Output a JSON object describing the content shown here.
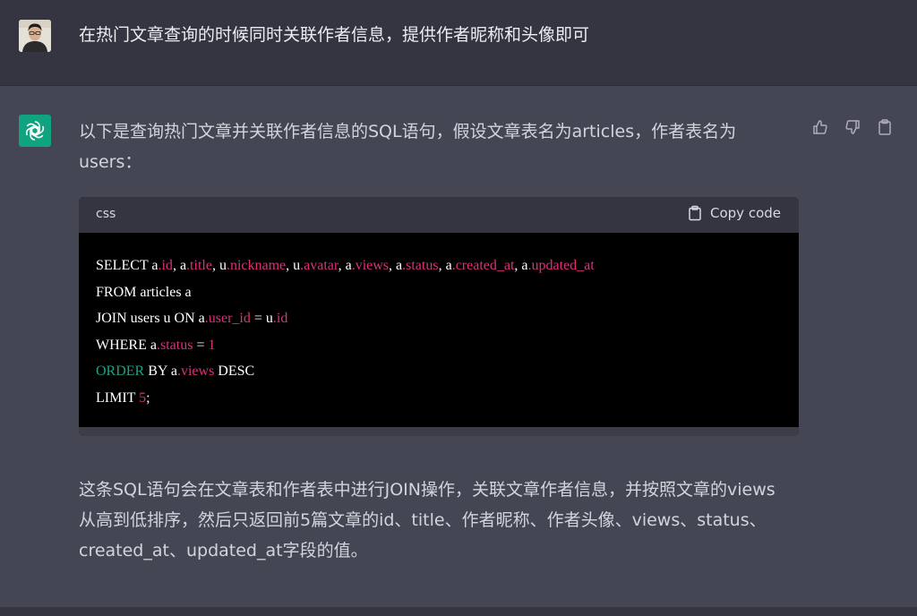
{
  "user_message": {
    "avatar_icon": "user-avatar-photo",
    "text": "在热门文章查询的时候同时关联作者信息，提供作者昵称和头像即可"
  },
  "assistant_message": {
    "avatar_icon": "openai-logo-icon",
    "accent_color": "#10a37f",
    "actions": [
      "thumbs-up-icon",
      "thumbs-down-icon",
      "clipboard-icon"
    ],
    "intro": "以下是查询热门文章并关联作者信息的SQL语句，假设文章表名为articles，作者表名为users：",
    "code_block": {
      "language": "css",
      "copy_label": "Copy code",
      "lines": [
        [
          {
            "t": "SELECT a",
            "c": "plain"
          },
          {
            "t": ".id",
            "c": "prop"
          },
          {
            "t": ", a",
            "c": "plain"
          },
          {
            "t": ".title",
            "c": "prop"
          },
          {
            "t": ", u",
            "c": "plain"
          },
          {
            "t": ".nickname",
            "c": "prop"
          },
          {
            "t": ", u",
            "c": "plain"
          },
          {
            "t": ".avatar",
            "c": "prop"
          },
          {
            "t": ", a",
            "c": "plain"
          },
          {
            "t": ".views",
            "c": "prop"
          },
          {
            "t": ", a",
            "c": "plain"
          },
          {
            "t": ".status",
            "c": "prop"
          },
          {
            "t": ", a",
            "c": "plain"
          },
          {
            "t": ".created_at",
            "c": "prop"
          },
          {
            "t": ", a",
            "c": "plain"
          },
          {
            "t": ".updated_at",
            "c": "prop"
          }
        ],
        [
          {
            "t": "FROM articles a",
            "c": "plain"
          }
        ],
        [
          {
            "t": "JOIN users u ON a",
            "c": "plain"
          },
          {
            "t": ".user_id",
            "c": "prop"
          },
          {
            "t": " = u",
            "c": "plain"
          },
          {
            "t": ".id",
            "c": "prop"
          }
        ],
        [
          {
            "t": "WHERE a",
            "c": "plain"
          },
          {
            "t": ".status",
            "c": "prop"
          },
          {
            "t": " = ",
            "c": "plain"
          },
          {
            "t": "1",
            "c": "num"
          }
        ],
        [
          {
            "t": "ORDER",
            "c": "kw"
          },
          {
            "t": " BY a",
            "c": "plain"
          },
          {
            "t": ".views",
            "c": "prop"
          },
          {
            "t": " DESC",
            "c": "plain"
          }
        ],
        [
          {
            "t": "LIMIT ",
            "c": "plain"
          },
          {
            "t": "5",
            "c": "num"
          },
          {
            "t": ";",
            "c": "plain"
          }
        ]
      ]
    },
    "summary": "这条SQL语句会在文章表和作者表中进行JOIN操作，关联文章作者信息，并按照文章的views从高到低排序，然后只返回前5篇文章的id、title、作者昵称、作者头像、views、status、created_at、updated_at字段的值。"
  }
}
